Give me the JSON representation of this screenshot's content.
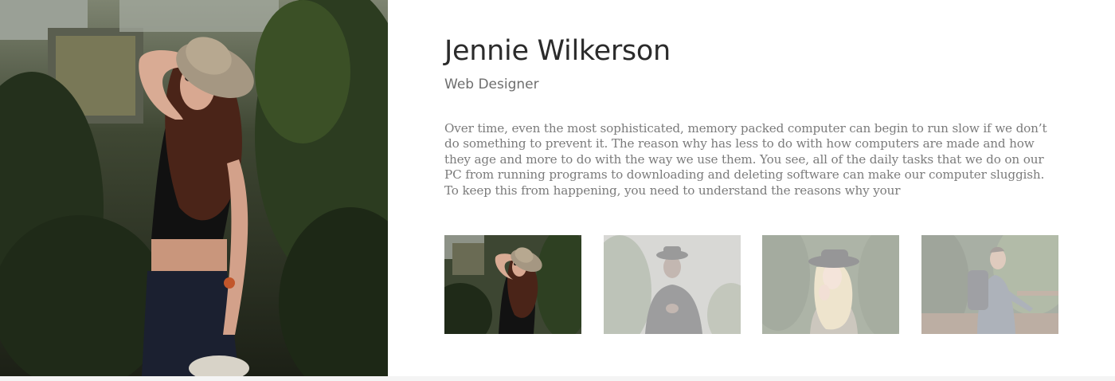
{
  "profile": {
    "name": "Jennie Wilkerson",
    "role": "Web Designer",
    "bio": "Over time, even the most sophisticated, memory packed computer can begin to run slow if we don’t do something to prevent it. The reason why has less to do with how computers are made and how they age and more to do with the way we use them. You see, all of the daily tasks that we do on our PC from running programs to downloading and deleting software can make our computer sluggish. To keep this from happening, you need to understand the reasons why your"
  },
  "hero": {
    "icon": "woman-in-hat-greenhouse-photo"
  },
  "thumbnails": [
    {
      "subject": "woman-in-hat-greenhouse",
      "active": true
    },
    {
      "subject": "man-in-hat-foggy-forest",
      "active": false
    },
    {
      "subject": "blonde-woman-black-hat",
      "active": false
    },
    {
      "subject": "hiker-with-backpack",
      "active": false
    }
  ],
  "colors": {
    "name": "#2b2b2b",
    "role": "#6e6e6e",
    "bio": "#7b7b7b",
    "background": "#ffffff",
    "page_bottom": "#f4f4f4"
  }
}
